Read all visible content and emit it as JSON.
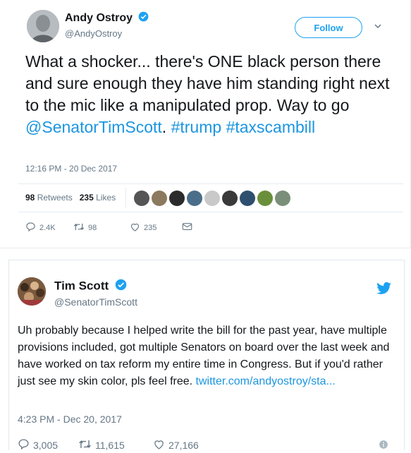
{
  "tweet1": {
    "name": "Andy Ostroy",
    "handle": "@AndyOstroy",
    "follow_label": "Follow",
    "text_part1": "What a shocker... there's ONE black person there and sure enough they have him standing right next to the mic like a manipulated prop. Way to go ",
    "mention": "@SenatorTimScott",
    "text_part2": ". ",
    "hashtag1": "#trump",
    "hashtag2": "#taxscambill",
    "timestamp": "12:16 PM - 20 Dec 2017",
    "retweets_count": "98",
    "retweets_label": "Retweets",
    "likes_count": "235",
    "likes_label": "Likes",
    "reply_count": "2.4K",
    "retweet_count": "98",
    "like_count": "235"
  },
  "tweet2": {
    "name": "Tim Scott",
    "handle": "@SenatorTimScott",
    "text": "Uh probably because I helped write the bill for the past year, have multiple provisions included, got multiple Senators on board over the last week and have worked on tax reform my entire time in Congress. But if you'd rather just see my skin color, pls feel free. ",
    "link": "twitter.com/andyostroy/sta...",
    "timestamp": "4:23 PM - Dec 20, 2017",
    "reply_count": "3,005",
    "retweet_count": "11,615",
    "like_count": "27,166"
  },
  "colors": {
    "link": "#1b95e0",
    "brand_blue": "#1da1f2",
    "muted": "#657786"
  }
}
